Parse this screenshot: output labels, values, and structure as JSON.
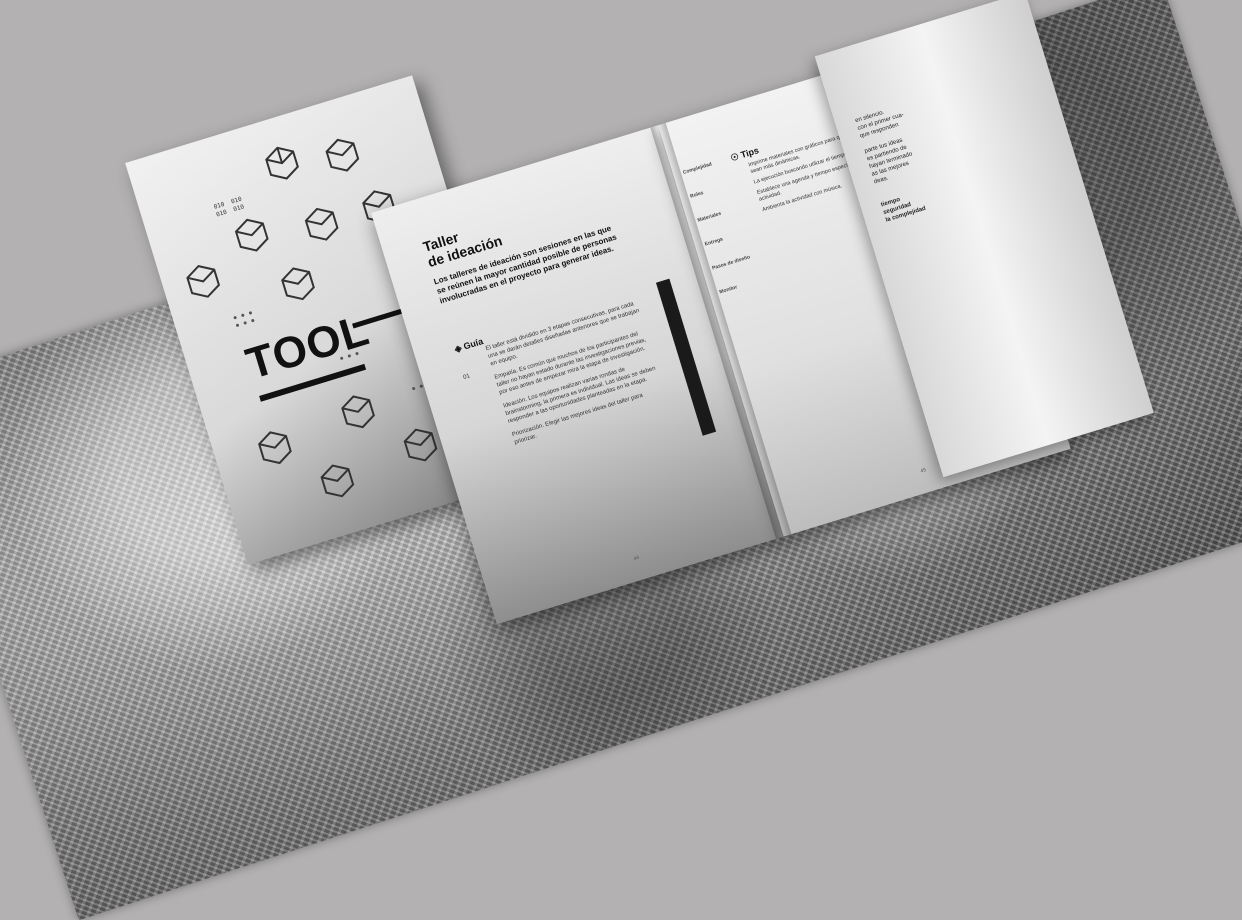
{
  "cover": {
    "title": "TOOL",
    "codes": [
      "010",
      "010",
      "010",
      "010",
      "010",
      "010"
    ]
  },
  "spread": {
    "title_line1": "Taller",
    "title_line2": "de ideación",
    "lead": "Los talleres de ideación son sesiones en las que se reúnen la mayor cantidad posible de personas involucradas en el proyecto para generar ideas.",
    "guia_label": "Guía",
    "step_number": "01",
    "body": [
      "El taller está dividido en 3 etapas consecutivas, para cada una se darán detalles diseñadas anteriores que se trabajan en equipo.",
      "Empatía. Es común que muchos de los participantes del taller no hayan estado durante las investigaciones previas, por eso antes de empezar mira la etapa de investigación.",
      "Ideación. Los equipos realizan varias rondas de brainstorming, la primera es individual. Las ideas se deben responder a las oportunidades planteadas en la etapa.",
      "Priorización. Elegir las mejores ideas del taller para priorizar."
    ],
    "tips_label": "Tips",
    "tips": [
      "Imprime materiales con gráficos para que las actividades sean más dinámicas.",
      "La ejecución buscando utilizar el tiempo del taller.",
      "Establece una agenda y tiempo específico para cada actividad.",
      "Ambienta la actividad con música."
    ],
    "side_labels": [
      "Complejidad",
      "Roles",
      "Materiales",
      "Entrega",
      "Pasos de diseño",
      "Monitor"
    ],
    "page_left": "44",
    "page_right": "45",
    "right_fragment": [
      "en silencio.",
      "con el primer cua-",
      "que responden",
      "parte tus ideas",
      "es partiendo de",
      "hayan terminado",
      "as las mejores",
      "deas.",
      "tiempo",
      "seguridad",
      "la complejidad"
    ]
  }
}
